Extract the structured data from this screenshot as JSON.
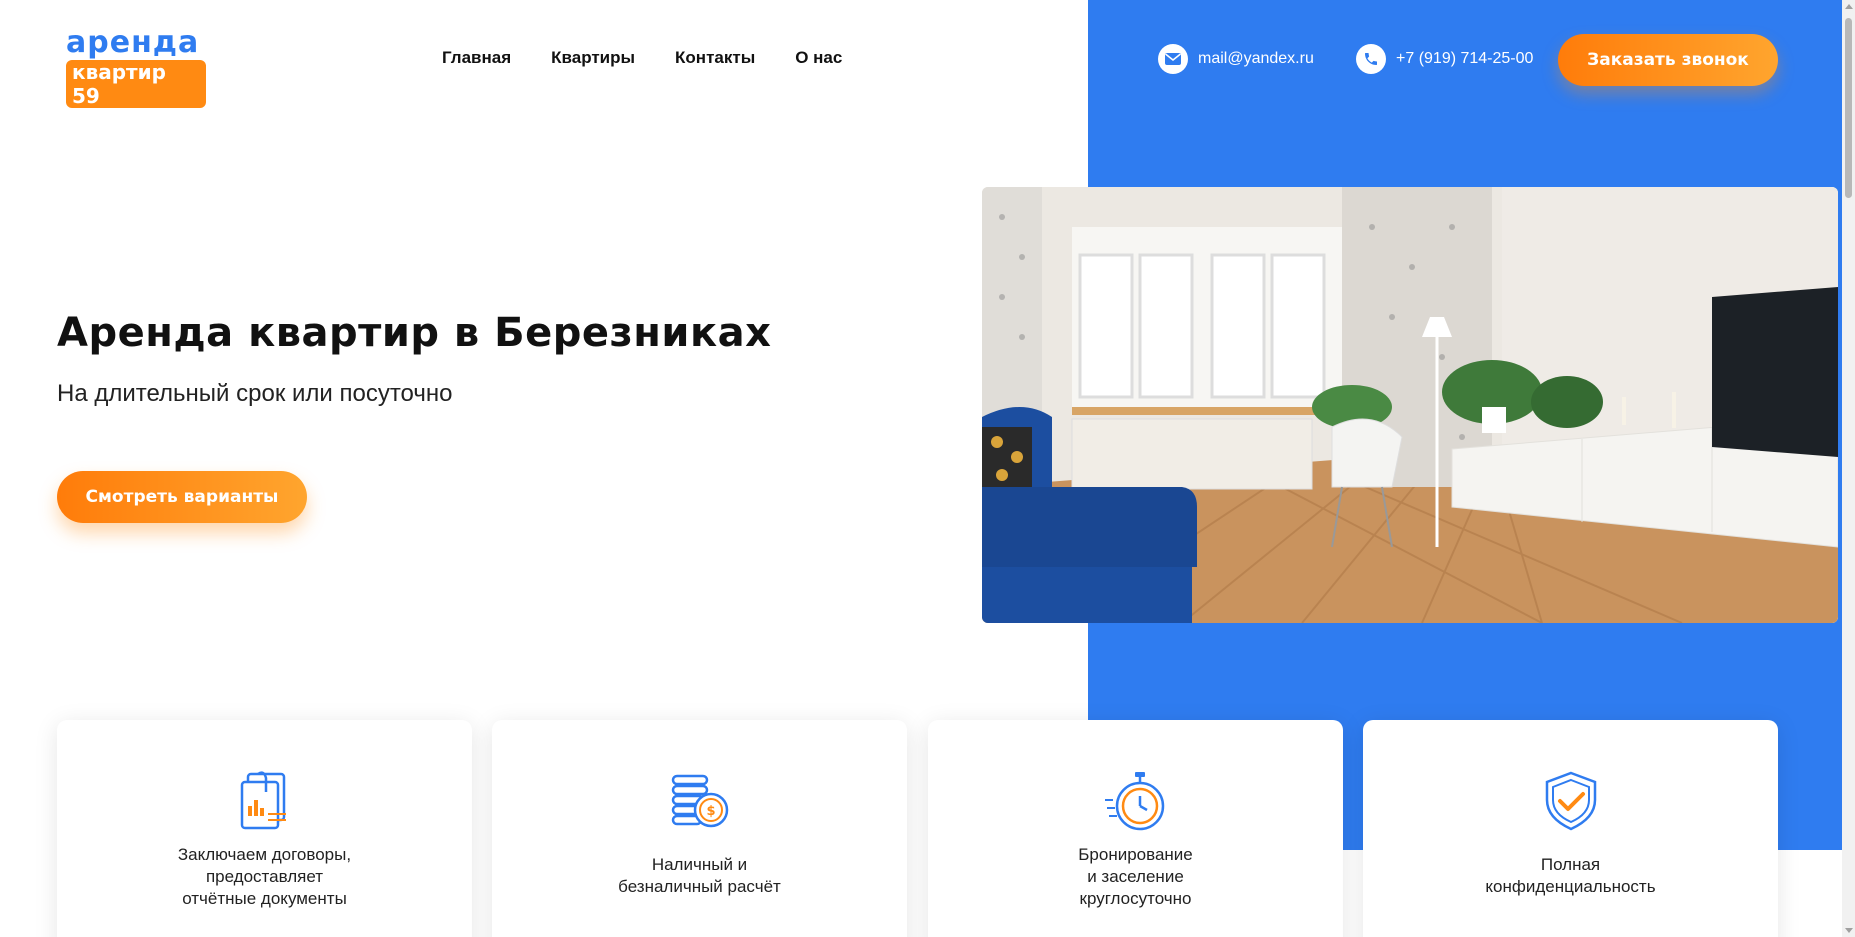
{
  "brand": {
    "logo_top": "аренда",
    "logo_bottom": "квартир 59"
  },
  "nav": {
    "items": [
      {
        "label": "Главная"
      },
      {
        "label": "Квартиры"
      },
      {
        "label": "Контакты"
      },
      {
        "label": "О нас"
      }
    ]
  },
  "contacts": {
    "email": "mail@yandex.ru",
    "phone": "+7 (919) 714-25-00",
    "call_button": "Заказать звонок"
  },
  "hero": {
    "title": "Аренда квартир в Березниках",
    "subtitle": "На длительный срок или посуточно",
    "button": "Смотреть варианты"
  },
  "features": [
    {
      "icon": "documents-icon",
      "text": "Заключаем договоры,\nпредоставляет\nотчётные документы"
    },
    {
      "icon": "coins-icon",
      "text": "Наличный и\nбезналичный расчёт"
    },
    {
      "icon": "stopwatch-icon",
      "text": "Бронирование\nи заселение\nкруглосуточно"
    },
    {
      "icon": "shield-check-icon",
      "text": "Полная\nконфиденциальность"
    }
  ],
  "colors": {
    "accent_blue": "#2f7cf0",
    "accent_orange": "#ff8a12"
  }
}
